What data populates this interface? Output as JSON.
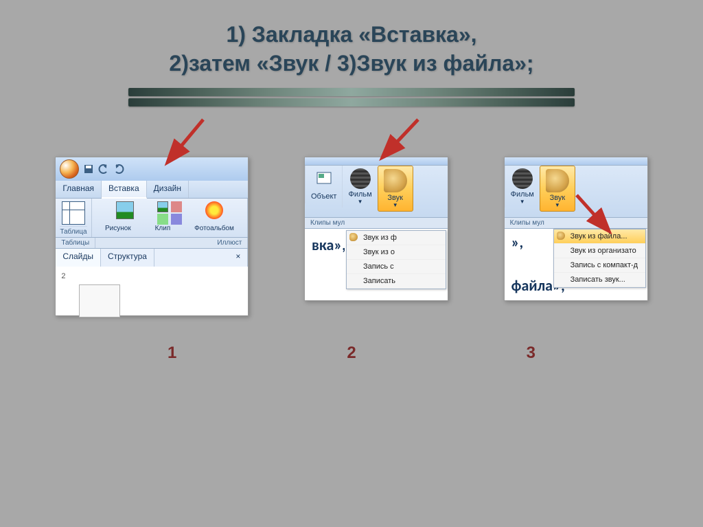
{
  "title_line1": "1) Закладка «Вставка»,",
  "title_line2": "2)затем  «Звук / 3)Звук из файла»;",
  "shot1": {
    "tabs": {
      "home": "Главная",
      "insert": "Вставка",
      "design": "Дизайн"
    },
    "ribbon": {
      "table": "Таблица",
      "picture": "Рисунок",
      "clip": "Клип",
      "photo": "Фотоальбом"
    },
    "group_tables": "Таблицы",
    "group_illus": "Иллюст",
    "panel_slides": "Слайды",
    "panel_structure": "Структура",
    "slide_num": "2"
  },
  "shot2": {
    "obj": "Объект",
    "film": "Фильм",
    "sound": "Звук",
    "group": "Клипы мул",
    "menu": {
      "m1": "Звук из ф",
      "m2": "Звук из о",
      "m3": "Запись с",
      "m4": "Записать"
    },
    "doc": "вка»,"
  },
  "shot3": {
    "film": "Фильм",
    "sound": "Звук",
    "group": "Клипы мул",
    "menu": {
      "m1": "Звук из файла...",
      "m2": "Звук из организато",
      "m3": "Запись с компакт-д",
      "m4": "Записать звук..."
    },
    "doc1": "»,",
    "doc2": "файла»;"
  },
  "nums": {
    "n1": "1",
    "n2": "2",
    "n3": "3"
  }
}
